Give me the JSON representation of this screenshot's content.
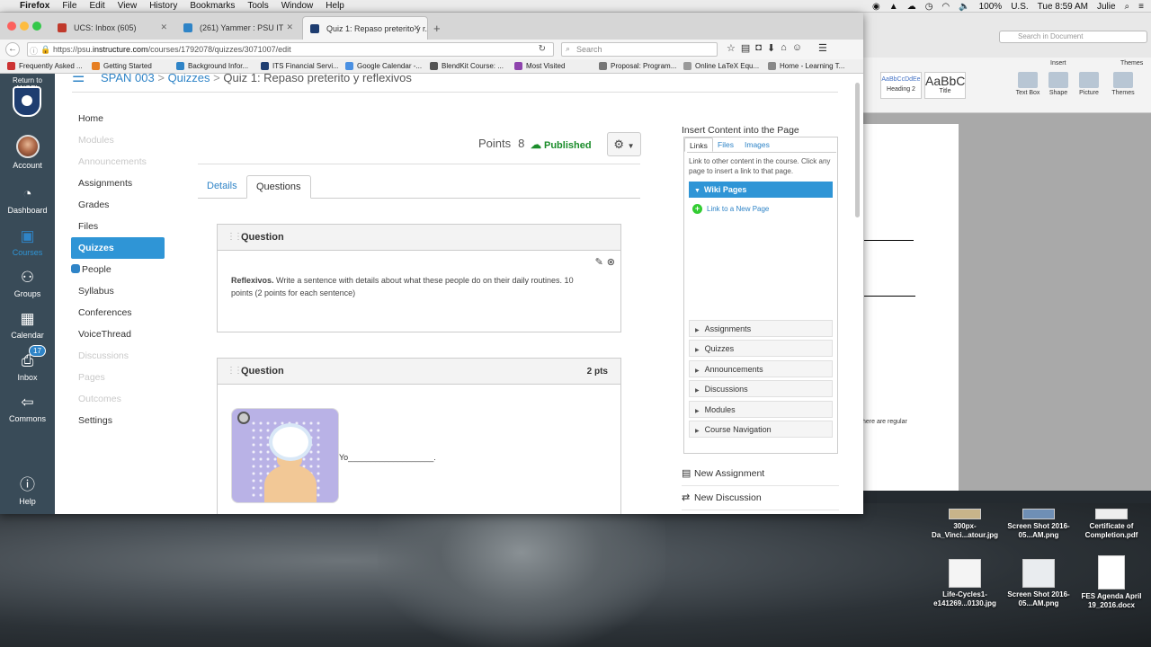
{
  "menubar": {
    "app": "Firefox",
    "items": [
      "File",
      "Edit",
      "View",
      "History",
      "Bookmarks",
      "Tools",
      "Window",
      "Help"
    ],
    "battery": "100%",
    "locale": "U.S.",
    "clock": "Tue 8:59 AM",
    "user": "Julie"
  },
  "browser": {
    "tabs": [
      {
        "title": "UCS: Inbox (605)",
        "color": "#c0392b"
      },
      {
        "title": "(261) Yammer : PSU IT",
        "color": "#2f84c7"
      },
      {
        "title": "Quiz 1: Repaso preterito y r...",
        "color": "#1e3d70"
      }
    ],
    "url_prefix": "https://psu.",
    "url_domain": "instructure.com",
    "url_path": "/courses/1792078/quizzes/3071007/edit",
    "search_placeholder": "Search",
    "bookmarks": [
      {
        "label": "Frequently Asked ...",
        "color": "#c33"
      },
      {
        "label": "Getting Started",
        "color": "#e67e22"
      },
      {
        "label": "Background Infor...",
        "color": "#2f84c7"
      },
      {
        "label": "ITS Financial Servi...",
        "color": "#1e3d70"
      },
      {
        "label": "Google Calendar -...",
        "color": "#4a90e2"
      },
      {
        "label": "BlendKit Course: ...",
        "color": "#555"
      },
      {
        "label": "Most Visited",
        "color": "#8e44ad"
      },
      {
        "label": "Proposal: Program...",
        "color": "#777"
      },
      {
        "label": "Online LaTeX Equ...",
        "color": "#999"
      },
      {
        "label": "Home - Learning T...",
        "color": "#888"
      }
    ]
  },
  "global_nav": {
    "return": "Return to ANGEL",
    "items": [
      {
        "label": "Account",
        "icon": "avatar"
      },
      {
        "label": "Dashboard",
        "icon": "dashboard-icon"
      },
      {
        "label": "Courses",
        "icon": "courses-icon"
      },
      {
        "label": "Groups",
        "icon": "groups-icon"
      },
      {
        "label": "Calendar",
        "icon": "calendar-icon"
      },
      {
        "label": "Inbox",
        "icon": "inbox-icon",
        "badge": "17"
      },
      {
        "label": "Commons",
        "icon": "commons-icon"
      },
      {
        "label": "Help",
        "icon": "help-icon"
      }
    ]
  },
  "breadcrumbs": {
    "course": "SPAN 003",
    "section": "Quizzes",
    "current": "Quiz 1: Repaso preterito y reflexivos"
  },
  "course_nav": [
    {
      "label": "Home",
      "state": "normal"
    },
    {
      "label": "Modules",
      "state": "dim"
    },
    {
      "label": "Announcements",
      "state": "dim"
    },
    {
      "label": "Assignments",
      "state": "normal"
    },
    {
      "label": "Grades",
      "state": "normal"
    },
    {
      "label": "Files",
      "state": "normal"
    },
    {
      "label": "Quizzes",
      "state": "active"
    },
    {
      "label": "People",
      "state": "normal"
    },
    {
      "label": "Syllabus",
      "state": "normal"
    },
    {
      "label": "Conferences",
      "state": "normal"
    },
    {
      "label": "VoiceThread",
      "state": "normal"
    },
    {
      "label": "Discussions",
      "state": "dim"
    },
    {
      "label": "Pages",
      "state": "dim"
    },
    {
      "label": "Outcomes",
      "state": "dim"
    },
    {
      "label": "Settings",
      "state": "normal"
    }
  ],
  "quiz": {
    "points_label": "Points",
    "points_value": "8",
    "status": "Published",
    "tabs": [
      "Details",
      "Questions"
    ],
    "questions": [
      {
        "title": "Question",
        "points": "",
        "bold_lead": "Reflexivos.",
        "text": " Write a sentence with details about what these people do on their daily routines. 10 points (2 points for each sentence)"
      },
      {
        "title": "Question",
        "points": "2 pts",
        "answer_line": "Yo___________________."
      }
    ]
  },
  "insert_content": {
    "title": "Insert Content into the Page",
    "tabs": [
      "Links",
      "Files",
      "Images"
    ],
    "help": "Link to other content in the course. Click any page to insert a link to that page.",
    "wiki_pages": "Wiki Pages",
    "new_page_link": "Link to a New Page",
    "sections": [
      "Assignments",
      "Quizzes",
      "Announcements",
      "Discussions",
      "Modules",
      "Course Navigation"
    ],
    "actions": [
      "New Assignment",
      "New Discussion"
    ]
  },
  "word": {
    "search_placeholder": "Search in Document",
    "tab_insert": "Insert",
    "tab_themes": "Themes",
    "styles": [
      "AaBbCcDdEe",
      "AaBbC"
    ],
    "style_names": [
      "Heading 2",
      "Title"
    ],
    "ribbon_buttons": [
      "Text Box",
      "Shape",
      "Picture",
      "Themes"
    ],
    "doc_text": "here are regular"
  },
  "desktop_icons": [
    {
      "label": "300px-Da_Vinci...atour.jpg"
    },
    {
      "label": "Screen Shot 2016-05...AM.png"
    },
    {
      "label": "Certificate of Completion.pdf"
    },
    {
      "label": "Life-Cycles1-e141269...0130.jpg"
    },
    {
      "label": "Screen Shot 2016-05...AM.png"
    },
    {
      "label": "FES Agenda April 19_2016.docx"
    }
  ]
}
